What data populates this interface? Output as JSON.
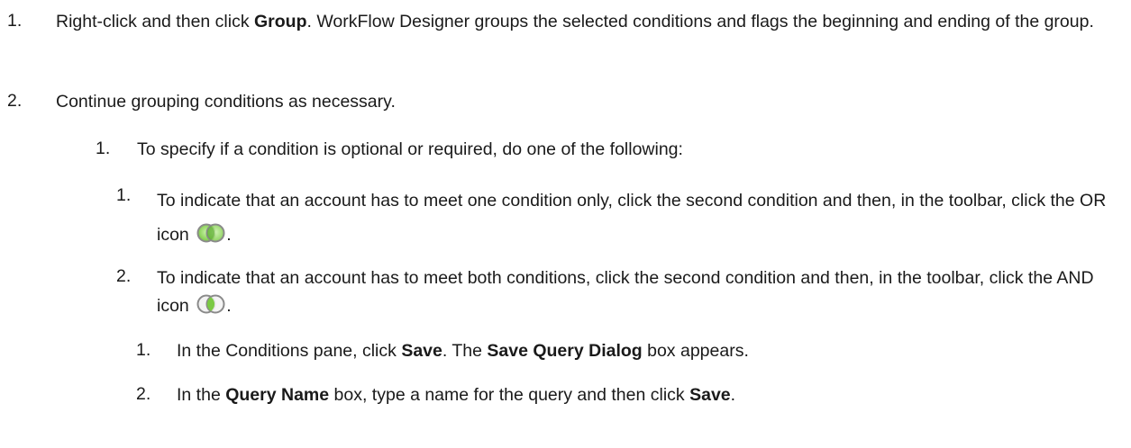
{
  "list": {
    "step1": {
      "number": "1.",
      "text_a": "Right-click and then click ",
      "bold_a": "Group",
      "text_b": ". WorkFlow Designer groups the selected conditions and flags the beginning and ending of the group."
    },
    "step2": {
      "number": "2.",
      "text": "Continue grouping conditions as necessary."
    },
    "sub1": {
      "number": "1.",
      "text": "To specify if a condition is optional or required, do one of the following:"
    },
    "opt1": {
      "number": "1.",
      "text_a": "To indicate that an account has to meet one condition only, click the second condition and then, in the toolbar, click the OR icon ",
      "icon": "or-icon",
      "text_b": "."
    },
    "opt2": {
      "number": "2.",
      "text_a": "To indicate that an account has to meet both conditions, click the second condition and then, in the toolbar, click the AND icon ",
      "icon": "and-icon",
      "text_b": "."
    },
    "save1": {
      "number": "1.",
      "text_a": "In the Conditions pane, click ",
      "bold_a": "Save",
      "text_b": ". The ",
      "bold_b": "Save Query Dialog",
      "text_c": " box appears."
    },
    "save2": {
      "number": "2.",
      "text_a": "In the ",
      "bold_a": "Query Name",
      "text_b": " box, type a name for the query and then click ",
      "bold_b": "Save",
      "text_c": "."
    }
  },
  "colors": {
    "icon_ring_outer": "#8a8a8a",
    "icon_fill_green": "#7ac943",
    "icon_fill_highlight": "#c9f2a8"
  }
}
